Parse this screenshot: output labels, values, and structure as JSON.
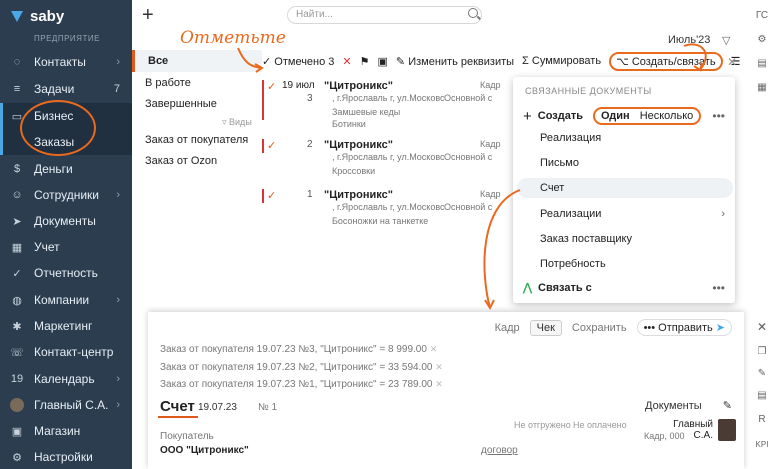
{
  "sidebar": {
    "brand": "saby",
    "section": "ПРЕДПРИЯТИЕ",
    "items": [
      {
        "label": "Контакты",
        "icon": "chat-icon",
        "glyph": "◌",
        "chevron": "›"
      },
      {
        "label": "Задачи",
        "icon": "tasks-icon",
        "glyph": "≡",
        "count": "7"
      },
      {
        "label": "Бизнес",
        "icon": "briefcase-icon",
        "glyph": "▭"
      },
      {
        "label": "Заказы",
        "icon": "",
        "glyph": ""
      },
      {
        "label": "Деньги",
        "icon": "money-icon",
        "glyph": "$"
      },
      {
        "label": "Сотрудники",
        "icon": "people-icon",
        "glyph": "☺",
        "chevron": "›"
      },
      {
        "label": "Документы",
        "icon": "send-icon",
        "glyph": "➤"
      },
      {
        "label": "Учет",
        "icon": "accounting-icon",
        "glyph": "▦"
      },
      {
        "label": "Отчетность",
        "icon": "report-icon",
        "glyph": "✓"
      },
      {
        "label": "Компании",
        "icon": "companies-icon",
        "glyph": "◍",
        "chevron": "›"
      },
      {
        "label": "Маркетинг",
        "icon": "marketing-icon",
        "glyph": "✱"
      },
      {
        "label": "Контакт-центр",
        "icon": "headset-icon",
        "glyph": "☏"
      },
      {
        "label": "Календарь",
        "icon": "calendar-icon",
        "glyph": "19",
        "chevron": "›"
      },
      {
        "label": "Главный С.А.",
        "icon": "avatar",
        "glyph": "",
        "chevron": "›"
      },
      {
        "label": "Магазин",
        "icon": "shop-icon",
        "glyph": "▣"
      },
      {
        "label": "Настройки",
        "icon": "settings-icon",
        "glyph": "⚙"
      }
    ]
  },
  "topbar": {
    "search_placeholder": "Найти...",
    "period": "Июль'23"
  },
  "right_toolbar": {
    "user_initials": "ГС",
    "r_label": "R",
    "kpi_label": "KPI"
  },
  "filters": {
    "items": [
      "Все",
      "В работе",
      "Завершенные",
      "Заказ от покупателя",
      "Заказ от Ozon"
    ],
    "types_label": "Виды"
  },
  "toolbar": {
    "marked": "Отмечено 3",
    "change_req": "Изменить реквизиты",
    "sum": "Суммировать",
    "create_link": "Создать/связать"
  },
  "callout": "Отметьте",
  "orders": [
    {
      "date": "19 июл",
      "number": "3",
      "customer": "\"Цитроникс\"",
      "address": ", г.Ярославль г, ул.Московс",
      "status": "Основной с",
      "kadr": "Кадр",
      "goods": [
        "Замшевые кеды",
        "Ботинки"
      ]
    },
    {
      "date": "",
      "number": "2",
      "customer": "\"Цитроникс\"",
      "address": ", г.Ярославль г, ул.Московс",
      "status": "Основной с",
      "kadr": "Кадр",
      "goods": [
        "Кроссовки"
      ]
    },
    {
      "date": "",
      "number": "1",
      "customer": "\"Цитроникс\"",
      "address": ", г.Ярославль г, ул.Московс",
      "status": "Основной с",
      "kadr": "Кадр",
      "goods": [
        "Босоножки на танкетке"
      ]
    }
  ],
  "dropdown": {
    "header": "СВЯЗАННЫЕ ДОКУМЕНТЫ",
    "create": "Создать",
    "seg_one": "Один",
    "seg_many": "Несколько",
    "items": [
      "Реализация",
      "Письмо",
      "Счет",
      "Реализации",
      "Заказ поставщику",
      "Потребность"
    ],
    "link": "Связать с"
  },
  "doc": {
    "tools": {
      "kadr": "Кадр",
      "check": "Чек",
      "save": "Сохранить",
      "send": "Отправить"
    },
    "refs": [
      "Заказ от покупателя 19.07.23 №3, \"Цитроникс\" = 8 999.00",
      "Заказ от покупателя 19.07.23 №2, \"Цитроникс\" = 33 594.00",
      "Заказ от покупателя 19.07.23 №1, \"Цитроникс\" = 23 789.00"
    ],
    "title": "Счет",
    "date": "19.07.23",
    "number": "№ 1",
    "documents": "Документы",
    "status_shipped": "Не отгружено",
    "status_paid": "Не оплачено",
    "buyer_label": "Покупатель",
    "buyer": "ООО \"Цитроникс\"",
    "contract": "договор",
    "manager": "Главный С.А.",
    "manager_sub": "Кадр, 000"
  },
  "colors": {
    "accent": "#e96a1e",
    "sidebar": "#2b3d4f",
    "brand_blue": "#49a8e6"
  }
}
